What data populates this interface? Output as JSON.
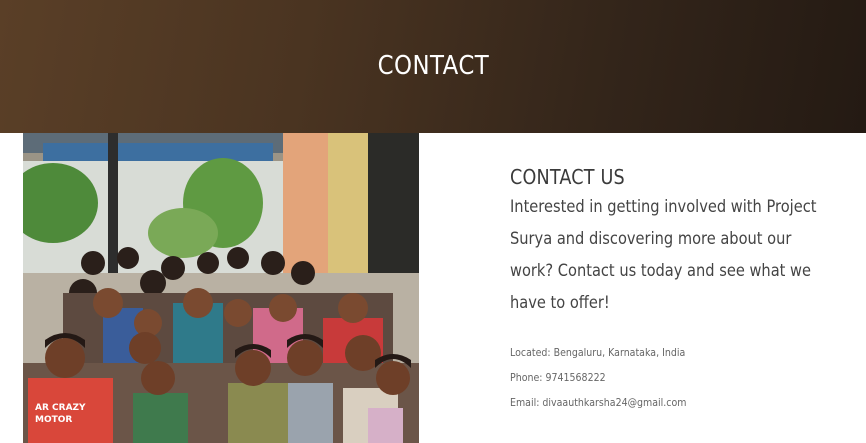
{
  "hero": {
    "title": "CONTACT"
  },
  "contact": {
    "heading": "CONTACT US",
    "intro": "Interested in getting involved with Project Surya and discovering more about our work? Contact us today and see what we have to offer!",
    "details": [
      {
        "label": "Located:",
        "value": "Bengaluru, Karnataka, India"
      },
      {
        "label": "Phone:",
        "value": "9741568222"
      },
      {
        "label": "Email:",
        "value": "divaauthkarsha24@gmail.com"
      }
    ]
  },
  "photo": {
    "shirt_text": "AR CRAZY\nMOTOR"
  }
}
